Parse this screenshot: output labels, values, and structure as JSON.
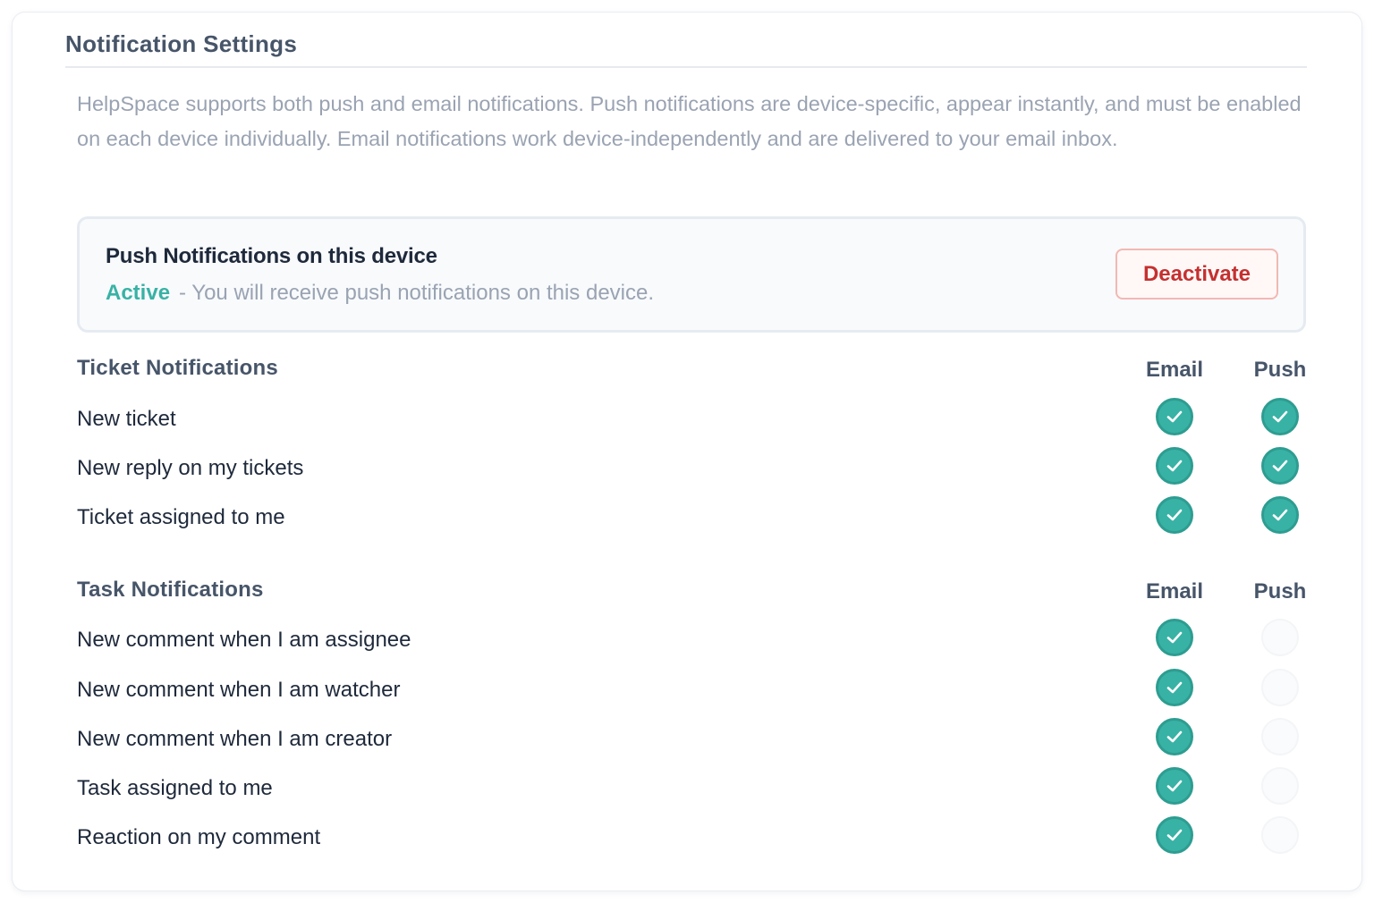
{
  "settings": {
    "title": "Notification Settings",
    "description": "HelpSpace supports both push and email notifications. Push notifications are device-specific, appear instantly, and must be enabled on each device individually. Email notifications work device-independently and are delivered to your email inbox."
  },
  "push_device": {
    "title": "Push Notifications on this device",
    "status": "Active",
    "separator": "-",
    "status_text": "You will receive push notifications on this device.",
    "button_label": "Deactivate"
  },
  "ticket_group": {
    "title": "Ticket Notifications",
    "email_header": "Email",
    "push_header": "Push",
    "rows": [
      {
        "label": "New ticket",
        "email": true,
        "push": true
      },
      {
        "label": "New reply on my tickets",
        "email": true,
        "push": true
      },
      {
        "label": "Ticket assigned to me",
        "email": true,
        "push": true
      }
    ]
  },
  "task_group": {
    "title": "Task Notifications",
    "email_header": "Email",
    "push_header": "Push",
    "rows": [
      {
        "label": "New comment when I am assignee",
        "email": true,
        "push": false
      },
      {
        "label": "New comment when I am watcher",
        "email": true,
        "push": false
      },
      {
        "label": "New comment when I am creator",
        "email": true,
        "push": false
      },
      {
        "label": "Task assigned to me",
        "email": true,
        "push": false
      },
      {
        "label": "Reaction on my comment",
        "email": true,
        "push": false
      }
    ]
  },
  "icons": {
    "enabled": "check-circle-icon"
  },
  "colors": {
    "accent": "#38b2a5",
    "danger": "#c53030",
    "heading": "#475569",
    "muted": "#9aa3b2"
  }
}
